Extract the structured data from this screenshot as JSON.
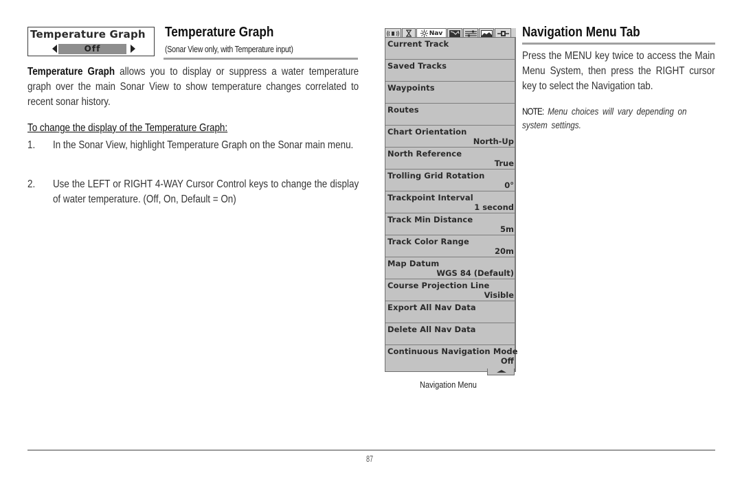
{
  "left_section": {
    "widget": {
      "title": "Temperature Graph",
      "value": "Off",
      "left_arrow_icon": "triangle-left",
      "right_arrow_icon": "triangle-right"
    },
    "title": "Temperature Graph",
    "subtitle": "(Sonar View only, with Temperature input)",
    "intro_bold": "Temperature Graph",
    "intro_rest": " allows you to display or suppress a water temperature graph over the main Sonar View to show temperature changes correlated to recent sonar history.",
    "procedure_heading": "To change the display of the Temperature Graph:",
    "steps": [
      {
        "num": "1.",
        "text": "In the Sonar View, highlight Temperature Graph on the Sonar main menu."
      },
      {
        "num": "2.",
        "text": "Use the LEFT or RIGHT 4-WAY Cursor Control keys to change the display of water temperature. (Off, On, Default = On)"
      }
    ]
  },
  "device_menu": {
    "tabs": [
      {
        "name": "sonar",
        "icon": "sonar-speaker-icon",
        "label": ""
      },
      {
        "name": "chart",
        "icon": "hourglass-icon",
        "label": ""
      },
      {
        "name": "nav",
        "icon": "sun-compass-icon",
        "label": "Nav",
        "active": true
      },
      {
        "name": "map",
        "icon": "map-icon",
        "label": ""
      },
      {
        "name": "setup",
        "icon": "sliders-icon",
        "label": ""
      },
      {
        "name": "views",
        "icon": "landscape-icon",
        "label": ""
      },
      {
        "name": "accessories",
        "icon": "plug-icon",
        "label": ""
      }
    ],
    "items": [
      {
        "label": "Current Track",
        "value": ""
      },
      {
        "label": "Saved Tracks",
        "value": ""
      },
      {
        "label": "Waypoints",
        "value": ""
      },
      {
        "label": "Routes",
        "value": ""
      },
      {
        "label": "Chart Orientation",
        "value": "North-Up"
      },
      {
        "label": "North Reference",
        "value": "True"
      },
      {
        "label": "Trolling Grid Rotation",
        "value": "0°"
      },
      {
        "label": "Trackpoint Interval",
        "value": "1 second"
      },
      {
        "label": "Track Min Distance",
        "value": "5m"
      },
      {
        "label": "Track Color Range",
        "value": "20m"
      },
      {
        "label": "Map Datum",
        "value": "WGS 84 (Default)"
      },
      {
        "label": "Course Projection Line",
        "value": "Visible"
      },
      {
        "label": "Export All Nav Data",
        "value": ""
      },
      {
        "label": "Delete All Nav Data",
        "value": ""
      },
      {
        "label": "Continuous Navigation Mode",
        "value": "Off"
      }
    ],
    "scroll_icon": "scroll-up-arrow",
    "caption": "Navigation Menu"
  },
  "right_section": {
    "title": "Navigation Menu Tab",
    "body": "Press the MENU key twice to access the Main Menu System, then press the RIGHT cursor key to select the Navigation tab.",
    "note_label": "NOTE:",
    "note_text": " Menu choices will vary depending on system settings."
  },
  "footer": {
    "page_number": "87"
  },
  "colors": {
    "menu_background": "#c3c3c3",
    "widget_value_background": "#8e8e8e",
    "rule": "#a0a0a0"
  }
}
